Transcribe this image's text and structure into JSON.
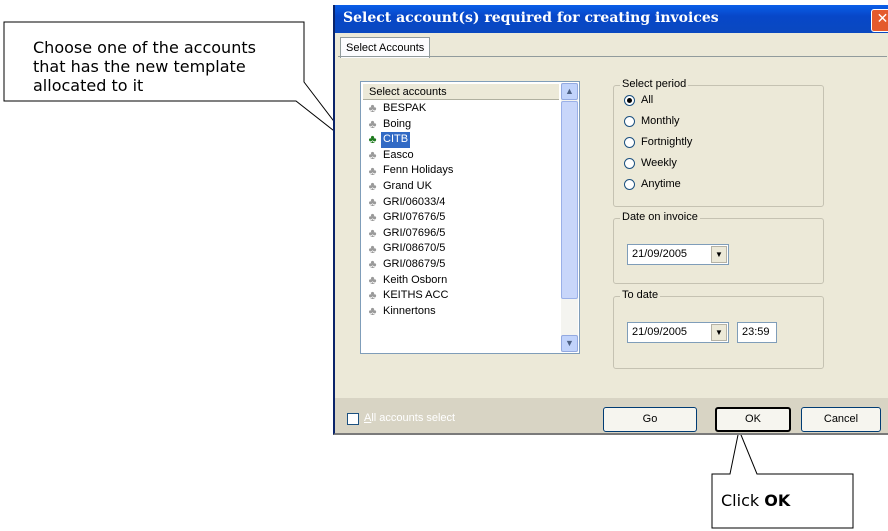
{
  "callouts": {
    "choose_account": "Choose one of the accounts that has the new template allocated to it",
    "click_ok_prefix": "Click ",
    "click_ok_bold": "OK"
  },
  "dialog": {
    "title": "Select account(s) required for creating invoices",
    "close_glyph": "✕",
    "tab": "Select Accounts",
    "list_header": "Select accounts",
    "accounts": [
      {
        "name": "BESPAK",
        "selected": false
      },
      {
        "name": "Boing",
        "selected": false
      },
      {
        "name": "CITB",
        "selected": true
      },
      {
        "name": "Easco",
        "selected": false
      },
      {
        "name": "Fenn Holidays",
        "selected": false
      },
      {
        "name": "Grand UK",
        "selected": false
      },
      {
        "name": "GRI/06033/4",
        "selected": false
      },
      {
        "name": "GRI/07676/5",
        "selected": false
      },
      {
        "name": "GRI/07696/5",
        "selected": false
      },
      {
        "name": "GRI/08670/5",
        "selected": false
      },
      {
        "name": "GRI/08679/5",
        "selected": false
      },
      {
        "name": "Keith Osborn",
        "selected": false
      },
      {
        "name": "KEITHS ACC",
        "selected": false
      },
      {
        "name": "Kinnertons",
        "selected": false
      }
    ],
    "account_icon": "tree-icon",
    "period": {
      "legend": "Select period",
      "options": [
        "All",
        "Monthly",
        "Fortnightly",
        "Weekly",
        "Anytime"
      ],
      "selected": "All"
    },
    "date_on_invoice": {
      "legend": "Date on invoice",
      "value": "21/09/2005"
    },
    "to_date": {
      "legend": "To date",
      "date": "21/09/2005",
      "time": "23:59"
    },
    "footer": {
      "all_accounts_first_letter": "A",
      "all_accounts_rest": "ll accounts select",
      "go": "Go",
      "ok": "OK",
      "cancel": "Cancel"
    }
  },
  "colors": {
    "title_bar": "#0a5ee8",
    "selection": "#316ac5",
    "dialog_face": "#ece9d8"
  }
}
